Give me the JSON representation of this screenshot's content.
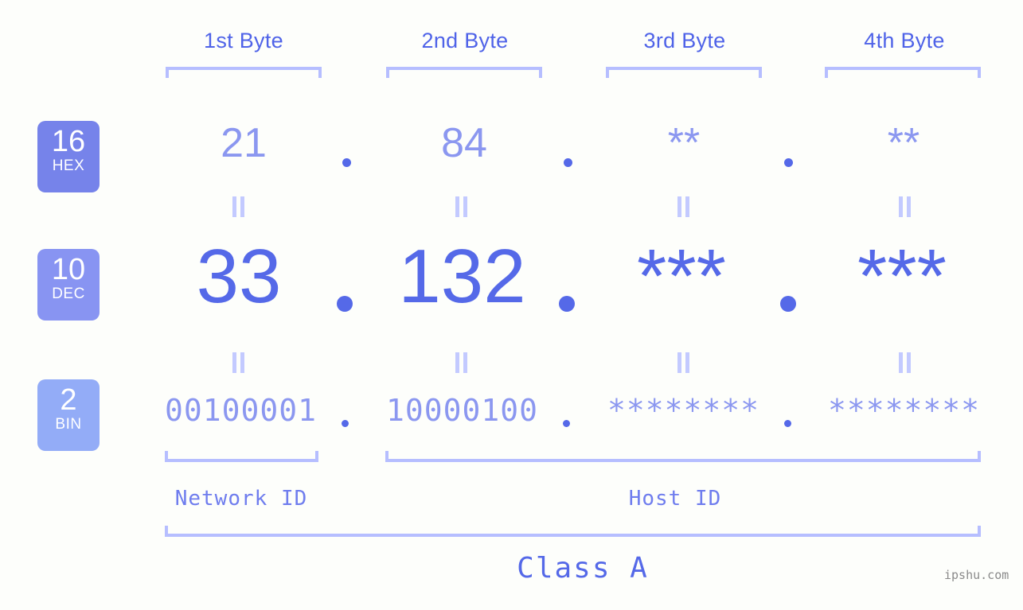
{
  "meta": {
    "background_color": "#fdfefb",
    "accent_color": "#5569e8",
    "light_accent_color": "#8b97f0",
    "bracket_color": "#b6beff",
    "watermark": "ipshu.com"
  },
  "byte_headers": [
    {
      "label": "1st Byte"
    },
    {
      "label": "2nd Byte"
    },
    {
      "label": "3rd Byte"
    },
    {
      "label": "4th Byte"
    }
  ],
  "bases": [
    {
      "number": "16",
      "name": "HEX",
      "color": "#7683ea"
    },
    {
      "number": "10",
      "name": "DEC",
      "color": "#8894f2"
    },
    {
      "number": "2",
      "name": "BIN",
      "color": "#93acf7"
    }
  ],
  "rows": {
    "hex": {
      "values": [
        "21",
        "84",
        "**",
        "**"
      ]
    },
    "dec": {
      "values": [
        "33",
        "132",
        "***",
        "***"
      ]
    },
    "bin": {
      "values": [
        "00100001",
        "10000100",
        "********",
        "********"
      ]
    }
  },
  "separator": ".",
  "equals_symbol": "=",
  "segments": [
    {
      "label": "Network ID"
    },
    {
      "label": "Host ID"
    }
  ],
  "class_label": "Class A"
}
